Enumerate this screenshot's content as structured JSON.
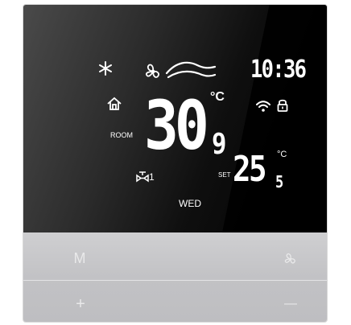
{
  "display": {
    "time": "10:36",
    "current_temp_whole": "30",
    "current_temp_decimal": "9",
    "current_unit": "°C",
    "room_label": "ROOM",
    "set_label": "SET",
    "set_temp_whole": "25",
    "set_temp_decimal": "5",
    "set_unit": "°C",
    "valve_label": "1",
    "day": "WED"
  },
  "icons": {
    "mode": "snowflake-icon",
    "fan": "fan-icon",
    "wind": "wind-waves-icon",
    "home": "home-icon",
    "wifi": "wifi-icon",
    "lock": "lock-icon",
    "valve": "valve-icon"
  },
  "buttons": {
    "mode": "M",
    "fan": "fan",
    "plus": "+",
    "minus": "—"
  },
  "colors": {
    "lcd_text": "#ffffff",
    "panel": "#c4c4c7"
  }
}
